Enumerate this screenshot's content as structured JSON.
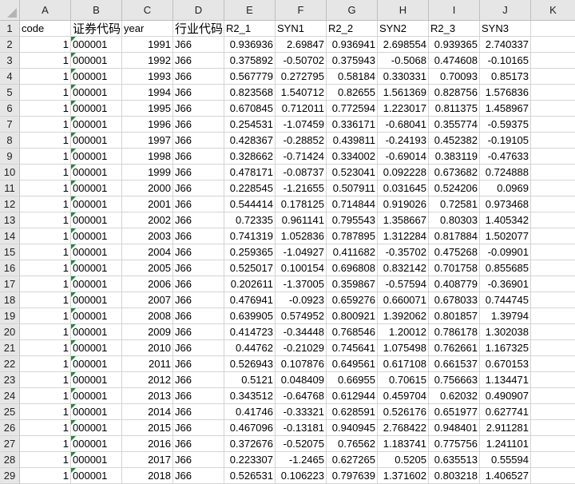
{
  "columns": [
    "A",
    "B",
    "C",
    "D",
    "E",
    "F",
    "G",
    "H",
    "I",
    "J",
    "K"
  ],
  "header_row": [
    "code",
    "证券代码",
    "year",
    "行业代码",
    "R2_1",
    "SYN1",
    "R2_2",
    "SYN2",
    "R2_3",
    "SYN3",
    ""
  ],
  "rows": [
    [
      "1",
      "000001",
      "1991",
      "J66",
      "0.936936",
      "2.69847",
      "0.936941",
      "2.698554",
      "0.939365",
      "2.740337"
    ],
    [
      "1",
      "000001",
      "1992",
      "J66",
      "0.375892",
      "-0.50702",
      "0.375943",
      "-0.5068",
      "0.474608",
      "-0.10165"
    ],
    [
      "1",
      "000001",
      "1993",
      "J66",
      "0.567779",
      "0.272795",
      "0.58184",
      "0.330331",
      "0.70093",
      "0.85173"
    ],
    [
      "1",
      "000001",
      "1994",
      "J66",
      "0.823568",
      "1.540712",
      "0.82655",
      "1.561369",
      "0.828756",
      "1.576836"
    ],
    [
      "1",
      "000001",
      "1995",
      "J66",
      "0.670845",
      "0.712011",
      "0.772594",
      "1.223017",
      "0.811375",
      "1.458967"
    ],
    [
      "1",
      "000001",
      "1996",
      "J66",
      "0.254531",
      "-1.07459",
      "0.336171",
      "-0.68041",
      "0.355774",
      "-0.59375"
    ],
    [
      "1",
      "000001",
      "1997",
      "J66",
      "0.428367",
      "-0.28852",
      "0.439811",
      "-0.24193",
      "0.452382",
      "-0.19105"
    ],
    [
      "1",
      "000001",
      "1998",
      "J66",
      "0.328662",
      "-0.71424",
      "0.334002",
      "-0.69014",
      "0.383119",
      "-0.47633"
    ],
    [
      "1",
      "000001",
      "1999",
      "J66",
      "0.478171",
      "-0.08737",
      "0.523041",
      "0.092228",
      "0.673682",
      "0.724888"
    ],
    [
      "1",
      "000001",
      "2000",
      "J66",
      "0.228545",
      "-1.21655",
      "0.507911",
      "0.031645",
      "0.524206",
      "0.0969"
    ],
    [
      "1",
      "000001",
      "2001",
      "J66",
      "0.544414",
      "0.178125",
      "0.714844",
      "0.919026",
      "0.72581",
      "0.973468"
    ],
    [
      "1",
      "000001",
      "2002",
      "J66",
      "0.72335",
      "0.961141",
      "0.795543",
      "1.358667",
      "0.80303",
      "1.405342"
    ],
    [
      "1",
      "000001",
      "2003",
      "J66",
      "0.741319",
      "1.052836",
      "0.787895",
      "1.312284",
      "0.817884",
      "1.502077"
    ],
    [
      "1",
      "000001",
      "2004",
      "J66",
      "0.259365",
      "-1.04927",
      "0.411682",
      "-0.35702",
      "0.475268",
      "-0.09901"
    ],
    [
      "1",
      "000001",
      "2005",
      "J66",
      "0.525017",
      "0.100154",
      "0.696808",
      "0.832142",
      "0.701758",
      "0.855685"
    ],
    [
      "1",
      "000001",
      "2006",
      "J66",
      "0.202611",
      "-1.37005",
      "0.359867",
      "-0.57594",
      "0.408779",
      "-0.36901"
    ],
    [
      "1",
      "000001",
      "2007",
      "J66",
      "0.476941",
      "-0.0923",
      "0.659276",
      "0.660071",
      "0.678033",
      "0.744745"
    ],
    [
      "1",
      "000001",
      "2008",
      "J66",
      "0.639905",
      "0.574952",
      "0.800921",
      "1.392062",
      "0.801857",
      "1.39794"
    ],
    [
      "1",
      "000001",
      "2009",
      "J66",
      "0.414723",
      "-0.34448",
      "0.768546",
      "1.20012",
      "0.786178",
      "1.302038"
    ],
    [
      "1",
      "000001",
      "2010",
      "J66",
      "0.44762",
      "-0.21029",
      "0.745641",
      "1.075498",
      "0.762661",
      "1.167325"
    ],
    [
      "1",
      "000001",
      "2011",
      "J66",
      "0.526943",
      "0.107876",
      "0.649561",
      "0.617108",
      "0.661537",
      "0.670153"
    ],
    [
      "1",
      "000001",
      "2012",
      "J66",
      "0.5121",
      "0.048409",
      "0.66955",
      "0.70615",
      "0.756663",
      "1.134471"
    ],
    [
      "1",
      "000001",
      "2013",
      "J66",
      "0.343512",
      "-0.64768",
      "0.612944",
      "0.459704",
      "0.62032",
      "0.490907"
    ],
    [
      "1",
      "000001",
      "2014",
      "J66",
      "0.41746",
      "-0.33321",
      "0.628591",
      "0.526176",
      "0.651977",
      "0.627741"
    ],
    [
      "1",
      "000001",
      "2015",
      "J66",
      "0.467096",
      "-0.13181",
      "0.940945",
      "2.768422",
      "0.948401",
      "2.911281"
    ],
    [
      "1",
      "000001",
      "2016",
      "J66",
      "0.372676",
      "-0.52075",
      "0.76562",
      "1.183741",
      "0.775756",
      "1.241101"
    ],
    [
      "1",
      "000001",
      "2017",
      "J66",
      "0.223307",
      "-1.2465",
      "0.627265",
      "0.5205",
      "0.635513",
      "0.55594"
    ],
    [
      "1",
      "000001",
      "2018",
      "J66",
      "0.526531",
      "0.106223",
      "0.797639",
      "1.371602",
      "0.803218",
      "1.406527"
    ]
  ],
  "colors": {
    "error_indicator": "#1f8a3a",
    "header_bg": "#e6e6e6",
    "gridline": "#d4d4d4"
  }
}
